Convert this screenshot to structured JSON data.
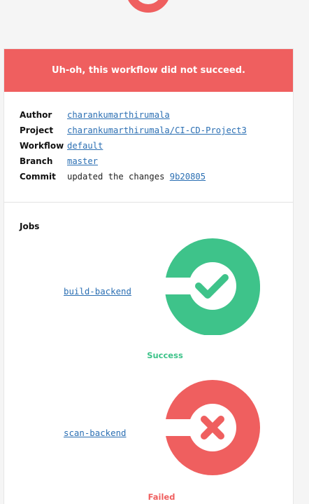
{
  "banner": {
    "message": "Uh-oh, this workflow did not succeed."
  },
  "details": [
    {
      "key": "Author",
      "value": "charankumarthirumala",
      "link": true
    },
    {
      "key": "Project",
      "value": "charankumarthirumala/CI-CD-Project3",
      "link": true
    },
    {
      "key": "Workflow",
      "value": "default",
      "link": true
    },
    {
      "key": "Branch",
      "value": "master",
      "link": true
    },
    {
      "key": "Commit",
      "prefix": "updated the changes ",
      "value": "9b20805",
      "link": true
    }
  ],
  "jobs_heading": "Jobs",
  "jobs": [
    {
      "name": "build-backend",
      "status": "Success",
      "status_color": "#3ec38a",
      "icon": "success-check-icon"
    },
    {
      "name": "scan-backend",
      "status": "Failed",
      "status_color": "#ef5f5f",
      "icon": "failed-x-icon"
    }
  ],
  "colors": {
    "failure": "#ef5f5f",
    "success": "#3ec38a",
    "link": "#2b6fb3"
  }
}
